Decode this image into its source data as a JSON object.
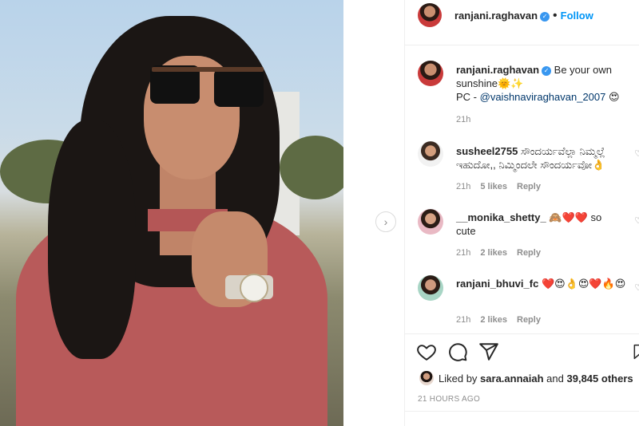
{
  "post": {
    "username": "ranjani.raghavan",
    "follow_label": "Follow",
    "dot": "•",
    "caption_line1": "Be your own",
    "caption_line2": "sunshine🌞✨",
    "caption_pc": "PC - ",
    "caption_mention": "@vaishnaviraghavan_2007",
    "caption_emoji": "😍",
    "caption_time": "21h"
  },
  "comments": [
    {
      "username": "susheel2755",
      "text": "ಸೌಂದರ್ಯವೆಲ್ಲಾ ನಿಮ್ಮಲ್ಲೆ ಇಹುದೋ,, ನಿಮ್ಮಿಂದಲೇ ಸೌಂದರ್ಯವೋ👌",
      "time": "21h",
      "likes": "5 likes",
      "reply": "Reply"
    },
    {
      "username": "__monika_shetty_",
      "text": "🙈❤️❤️ so cute",
      "time": "21h",
      "likes": "2 likes",
      "reply": "Reply"
    },
    {
      "username": "ranjani_bhuvi_fc",
      "text": "❤️😍👌😍❤️🔥😍",
      "time": "21h",
      "likes": "2 likes",
      "reply": "Reply"
    }
  ],
  "likes": {
    "prefix": "Liked by ",
    "user": "sara.annaiah",
    "mid": " and ",
    "count": "39,845 others"
  },
  "time_ago": "21 HOURS AGO",
  "icons": {
    "like": "heart-icon",
    "comment": "comment-icon",
    "share": "share-icon",
    "next": "chevron-right-icon",
    "verified": "verified-badge-icon"
  }
}
